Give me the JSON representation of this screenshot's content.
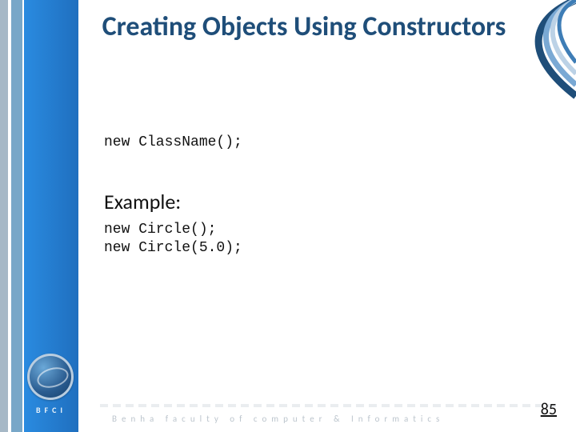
{
  "title": "Creating Objects Using Constructors",
  "code_syntax": "new ClassName();",
  "example_label": "Example:",
  "example_code_1": "new Circle();",
  "example_code_2": "new Circle(5.0);",
  "footer_brand": "BFCI",
  "footer_text": "Benha   faculty   of   computer   &   Informatics",
  "page_number": "85"
}
